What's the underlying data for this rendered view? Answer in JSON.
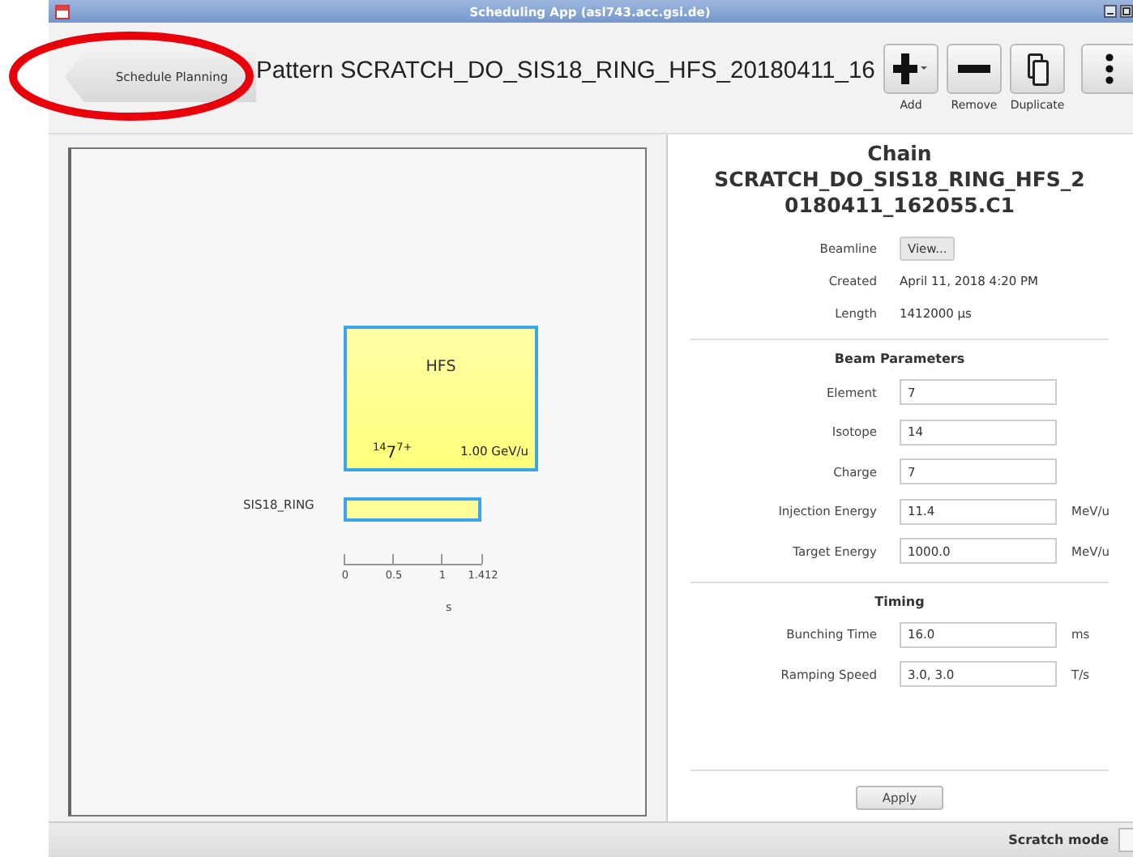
{
  "window": {
    "title": "Scheduling App (asl743.acc.gsi.de)"
  },
  "toolbar": {
    "back_button": "Schedule Planning",
    "pattern_title": "Pattern SCRATCH_DO_SIS18_RING_HFS_20180411_16",
    "buttons": [
      {
        "kind": "add",
        "label": "Add"
      },
      {
        "kind": "remove",
        "label": "Remove"
      },
      {
        "kind": "duplicate",
        "label": "Duplicate"
      },
      {
        "kind": "more"
      }
    ]
  },
  "diagram": {
    "block": {
      "name": "HFS",
      "ion": "$^{14}$7$^{7+}$",
      "energy": "1.00 GeV/u"
    },
    "lane": "SIS18_RING",
    "axis": {
      "ticks": [
        "0",
        "0.5",
        "1",
        "1.412"
      ],
      "label": "s"
    }
  },
  "details": {
    "heading": "Chain",
    "name": "SCRATCH_DO_SIS18_RING_HFS_20180411_162055.C1",
    "info": [
      {
        "kind": "button",
        "label": "Beamline",
        "value": "View..."
      },
      {
        "kind": "text",
        "label": "Created",
        "value": "April 11, 2018 4:20 PM"
      },
      {
        "kind": "text",
        "label": "Length",
        "value": "1412000 µs"
      }
    ],
    "sections": [
      {
        "title": "Beam Parameters",
        "fields": [
          {
            "label": "Element",
            "value": "7"
          },
          {
            "label": "Isotope",
            "value": "14"
          },
          {
            "label": "Charge",
            "value": "7"
          },
          {
            "label": "Injection Energy",
            "value": "11.4",
            "unit": "MeV/u"
          },
          {
            "label": "Target Energy",
            "value": "1000.0",
            "unit": "MeV/u"
          }
        ]
      },
      {
        "title": "Timing",
        "fields": [
          {
            "label": "Bunching Time",
            "value": "16.0",
            "unit": "ms"
          },
          {
            "label": "Ramping Speed",
            "value": "3.0, 3.0",
            "unit": "T/s"
          }
        ]
      }
    ],
    "apply_button": "Apply"
  },
  "status_bar": {
    "mode": "Scratch mode"
  }
}
